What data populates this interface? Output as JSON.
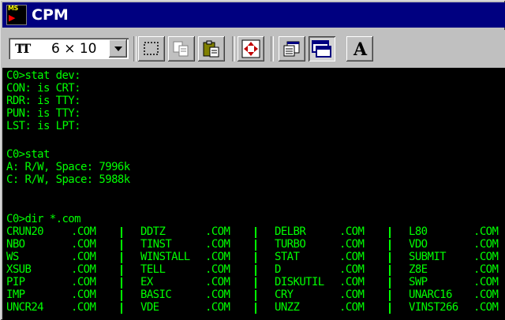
{
  "window": {
    "title": "CPM"
  },
  "toolbar": {
    "font_glyph": "TT",
    "font_size": "6 × 10",
    "buttons": [
      "mark-icon",
      "copy-icon",
      "paste-icon",
      "fullscreen-icon",
      "properties-icon",
      "background-icon",
      "font-icon"
    ]
  },
  "console": {
    "lines": [
      "C0>stat dev:",
      "CON: is CRT:",
      "RDR: is TTY:",
      "PUN: is TTY:",
      "LST: is LPT:",
      "",
      "C0>stat",
      "A: R/W, Space: 7996k",
      "C: R/W, Space: 5988k",
      "",
      "",
      "C0>dir *.com"
    ],
    "listing": [
      [
        "CRUN20",
        ".COM",
        "DDTZ",
        ".COM",
        "DELBR",
        ".COM",
        "L80",
        ".COM"
      ],
      [
        "NBO",
        ".COM",
        "TINST",
        ".COM",
        "TURBO",
        ".COM",
        "VDO",
        ".COM"
      ],
      [
        "WS",
        ".COM",
        "WINSTALL",
        ".COM",
        "STAT",
        ".COM",
        "SUBMIT",
        ".COM"
      ],
      [
        "XSUB",
        ".COM",
        "TELL",
        ".COM",
        "D",
        ".COM",
        "Z8E",
        ".COM"
      ],
      [
        "PIP",
        ".COM",
        "EX",
        ".COM",
        "DISKUTIL",
        ".COM",
        "SWP",
        ".COM"
      ],
      [
        "IMP",
        ".COM",
        "BASIC",
        ".COM",
        "CRY",
        ".COM",
        "UNARC16",
        ".COM"
      ],
      [
        "UNCR24",
        ".COM",
        "VDE",
        ".COM",
        "UNZZ",
        ".COM",
        "VINST266",
        ".COM"
      ]
    ]
  },
  "colors": {
    "titlebar": "#000080",
    "console_bg": "#000000",
    "console_text": "#00ff00"
  }
}
